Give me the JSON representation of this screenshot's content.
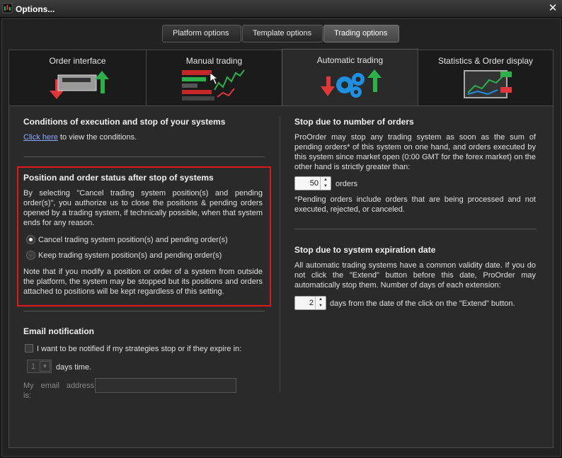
{
  "window": {
    "title": "Options...",
    "close_symbol": "✕"
  },
  "top_tabs": [
    {
      "label": "Platform options",
      "active": false
    },
    {
      "label": "Template options",
      "active": false
    },
    {
      "label": "Trading options",
      "active": true
    }
  ],
  "cards": [
    {
      "label": "Order interface",
      "active": false
    },
    {
      "label": "Manual trading",
      "active": false
    },
    {
      "label": "Automatic trading",
      "active": true
    },
    {
      "label": "Statistics & Order display",
      "active": false
    }
  ],
  "left": {
    "conditions": {
      "heading": "Conditions of execution and stop of your systems",
      "link": "Click here",
      "text": " to view the conditions."
    },
    "position_status": {
      "heading": "Position and order status after stop of systems",
      "description": "By selecting \"Cancel trading system position(s) and pending order(s)\", you authorize us to close the positions & pending orders opened by a trading system, if technically possible, when that system ends for any reason.",
      "options": [
        {
          "label": "Cancel trading system position(s) and pending order(s)",
          "selected": true
        },
        {
          "label": "Keep trading system position(s) and pending order(s)",
          "selected": false
        }
      ],
      "note": "Note that if you modify a position or order of a system from outside the platform, the system may be stopped but its positions and orders attached to positions will be kept regardless of this setting."
    },
    "email": {
      "heading": "Email notification",
      "checkbox_label": "I want to be notified if my strategies stop or if they expire in:",
      "checked": false,
      "days_value": "1",
      "days_label": "days time.",
      "address_label": "My email address is:",
      "address_value": ""
    }
  },
  "right": {
    "orders": {
      "heading": "Stop due to number of orders",
      "description": "ProOrder may stop any trading system as soon as the sum of pending orders* of this system on one hand, and orders executed by this system since market open (0:00 GMT for the forex market) on the other hand is strictly greater than:",
      "value": "50",
      "unit": "orders",
      "footnote": "*Pending orders include orders that are being processed and not executed, rejected, or canceled."
    },
    "expiration": {
      "heading": "Stop due to system expiration date",
      "description": "All automatic trading systems have a common validity date. If you do not click the \"Extend\" button before this date, ProOrder may automatically stop them. Number of days of each extension:",
      "value": "2",
      "unit": "days from the date of the click on the \"Extend\" button."
    }
  },
  "colors": {
    "highlight": "#e01818",
    "link": "#8aa8ff",
    "accent_green": "#2bb04a",
    "accent_red": "#e2373a",
    "accent_blue": "#1f8fe0"
  }
}
